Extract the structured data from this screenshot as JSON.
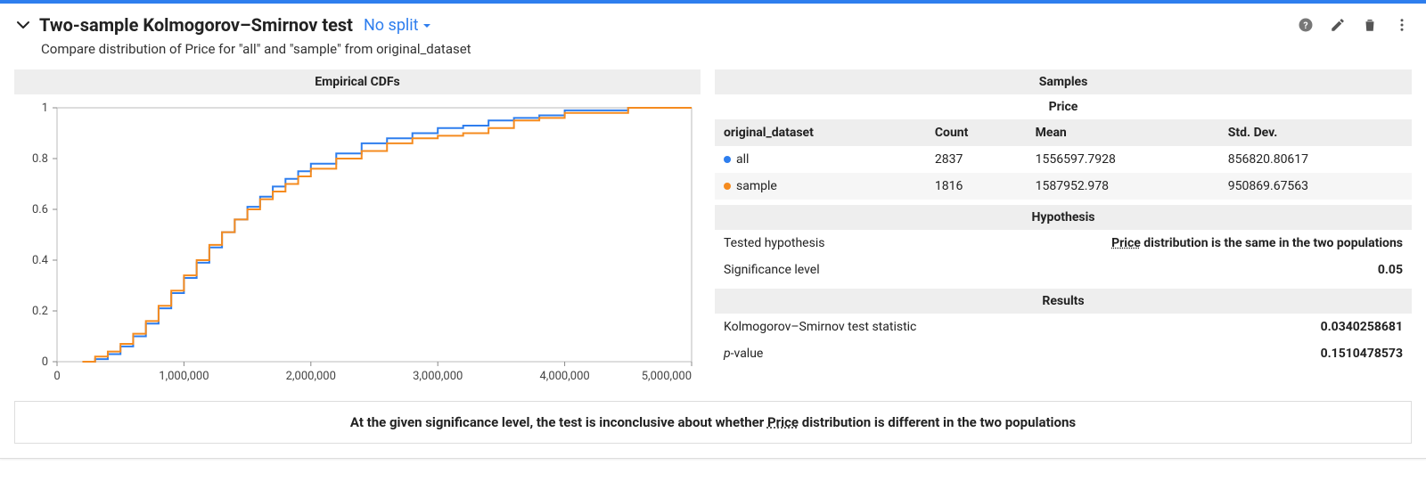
{
  "header": {
    "title": "Two-sample Kolmogorov–Smirnov test",
    "split_label": "No split",
    "subtitle": "Compare distribution of Price for \"all\" and \"sample\" from original_dataset"
  },
  "samples": {
    "section_title": "Samples",
    "value_label": "Price",
    "group_col": "original_dataset",
    "columns": [
      "Count",
      "Mean",
      "Std. Dev."
    ],
    "rows": [
      {
        "color": "#2e7eee",
        "name": "all",
        "count": "2837",
        "mean": "1556597.7928",
        "std": "856820.80617"
      },
      {
        "color": "#f58b1f",
        "name": "sample",
        "count": "1816",
        "mean": "1587952.978",
        "std": "950869.67563"
      }
    ]
  },
  "hypothesis": {
    "section_title": "Hypothesis",
    "tested_label": "Tested hypothesis",
    "tested_value_prefix": "Price",
    "tested_value_rest": " distribution is the same in the two populations",
    "sig_label": "Significance level",
    "sig_value": "0.05"
  },
  "results": {
    "section_title": "Results",
    "stat_label": "Kolmogorov–Smirnov test statistic",
    "stat_value": "0.0340258681",
    "p_label_prefix": "p",
    "p_label_rest": "-value",
    "p_value": "0.1510478573"
  },
  "footer": {
    "prefix": "At the given significance level, the test is inconclusive about whether ",
    "under": "Price",
    "rest": " distribution is different in the two populations"
  },
  "chart_data": {
    "type": "line",
    "title": "Empirical CDFs",
    "xlabel": "",
    "ylabel": "",
    "xlim": [
      0,
      5000000
    ],
    "ylim": [
      0,
      1
    ],
    "xticks": [
      0,
      1000000,
      2000000,
      3000000,
      4000000,
      5000000
    ],
    "xtick_labels": [
      "0",
      "1,000,000",
      "2,000,000",
      "3,000,000",
      "4,000,000",
      "5,000,000"
    ],
    "yticks": [
      0,
      0.2,
      0.4,
      0.6,
      0.8,
      1
    ],
    "ytick_labels": [
      "0",
      "0.2",
      "0.4",
      "0.6",
      "0.8",
      "1"
    ],
    "series": [
      {
        "name": "all",
        "color": "#2e7eee",
        "x": [
          200000,
          300000,
          400000,
          500000,
          600000,
          700000,
          800000,
          900000,
          1000000,
          1100000,
          1200000,
          1300000,
          1400000,
          1500000,
          1600000,
          1700000,
          1800000,
          1900000,
          2000000,
          2200000,
          2400000,
          2600000,
          2800000,
          3000000,
          3200000,
          3400000,
          3600000,
          3800000,
          4000000,
          4500000,
          5000000
        ],
        "y": [
          0.0,
          0.01,
          0.03,
          0.06,
          0.1,
          0.15,
          0.21,
          0.27,
          0.33,
          0.39,
          0.45,
          0.51,
          0.56,
          0.61,
          0.65,
          0.69,
          0.72,
          0.75,
          0.78,
          0.82,
          0.86,
          0.88,
          0.9,
          0.92,
          0.93,
          0.95,
          0.96,
          0.97,
          0.99,
          1.0,
          1.0
        ]
      },
      {
        "name": "sample",
        "color": "#f58b1f",
        "x": [
          200000,
          300000,
          400000,
          500000,
          600000,
          700000,
          800000,
          900000,
          1000000,
          1100000,
          1200000,
          1300000,
          1400000,
          1500000,
          1600000,
          1700000,
          1800000,
          1900000,
          2000000,
          2200000,
          2400000,
          2600000,
          2800000,
          3000000,
          3200000,
          3400000,
          3600000,
          3800000,
          4000000,
          4500000,
          5000000
        ],
        "y": [
          0.0,
          0.02,
          0.04,
          0.07,
          0.11,
          0.16,
          0.22,
          0.28,
          0.34,
          0.4,
          0.46,
          0.51,
          0.56,
          0.6,
          0.64,
          0.67,
          0.7,
          0.73,
          0.76,
          0.8,
          0.83,
          0.86,
          0.88,
          0.89,
          0.9,
          0.92,
          0.95,
          0.96,
          0.98,
          1.0,
          1.0
        ]
      }
    ]
  }
}
